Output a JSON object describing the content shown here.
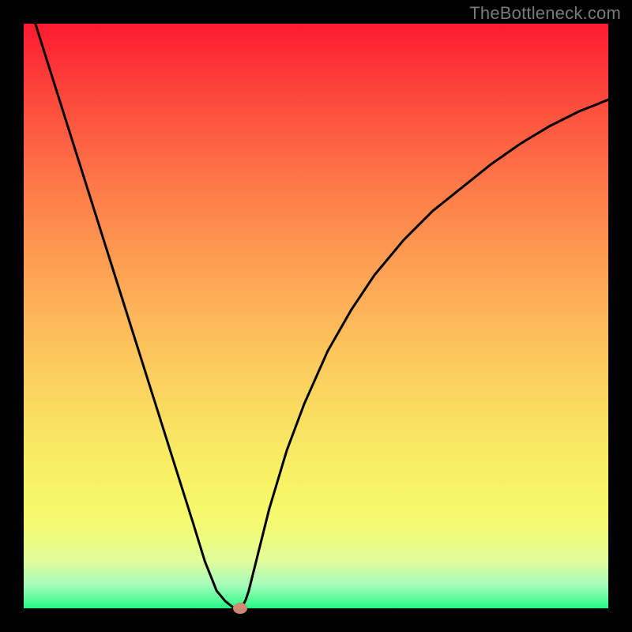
{
  "watermark": "TheBottleneck.com",
  "chart_data": {
    "type": "line",
    "title": "",
    "xlabel": "",
    "ylabel": "",
    "xlim": [
      0,
      100
    ],
    "ylim": [
      0,
      100
    ],
    "grid": false,
    "legend": false,
    "background": "gradient-green-to-red",
    "series": [
      {
        "name": "bottleneck-curve",
        "color": "#000000",
        "x": [
          2,
          5,
          8,
          11,
          14,
          17,
          20,
          23,
          26,
          29,
          31,
          33,
          34.5,
          35.5,
          36,
          36.5,
          37,
          37.5,
          38,
          38.5,
          39,
          40,
          42,
          45,
          48,
          52,
          56,
          60,
          65,
          70,
          75,
          80,
          85,
          90,
          95,
          100
        ],
        "values": [
          100,
          90.5,
          81,
          71.5,
          62,
          52.5,
          43,
          33.5,
          24,
          14.5,
          8,
          3,
          1.2,
          0.4,
          0,
          0,
          0,
          0.5,
          1.5,
          3,
          5,
          9,
          17,
          27,
          35,
          44,
          51,
          57,
          63,
          68,
          72,
          76,
          79.5,
          82.5,
          85,
          87
        ]
      }
    ],
    "marker": {
      "name": "optimal-point",
      "x": 37,
      "y": 0,
      "color": "#d18874"
    }
  }
}
